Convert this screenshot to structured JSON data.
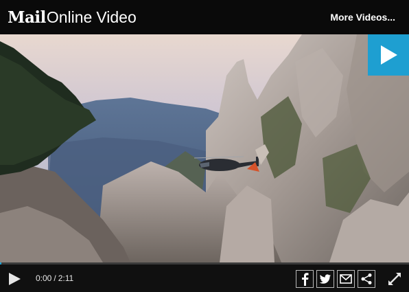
{
  "header": {
    "brand_mail": "Mail",
    "brand_online": "Online",
    "brand_video": "Video",
    "more_videos_label": "More Videos..."
  },
  "player": {
    "current_time": "0:00",
    "separator": "/",
    "duration": "2:11",
    "progress": 0.0
  },
  "icons": {
    "big_play": "play-icon",
    "control_play": "play-icon",
    "facebook": "facebook-icon",
    "twitter": "twitter-icon",
    "email": "email-icon",
    "share": "share-icon",
    "fullscreen": "fullscreen-icon"
  },
  "colors": {
    "accent": "#1e9fd1",
    "bar": "#0a0a0a"
  }
}
